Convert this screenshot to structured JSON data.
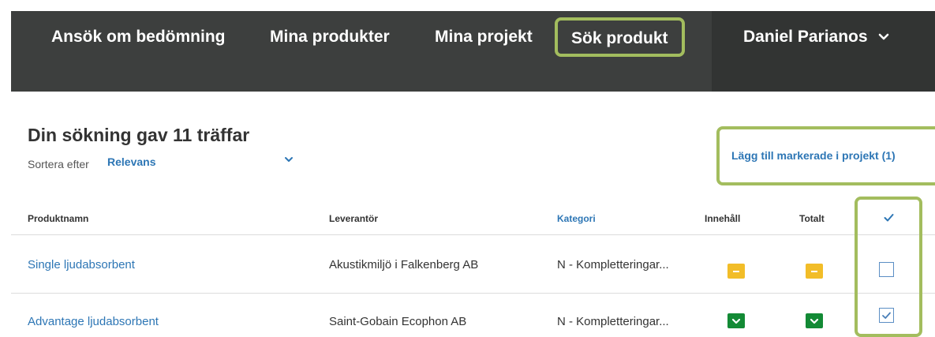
{
  "nav": {
    "items": [
      "Ansök om bedömning",
      "Mina produkter",
      "Mina projekt",
      "Sök produkt"
    ],
    "user_name": "Daniel Parianos"
  },
  "results": {
    "title": "Din sökning gav 11 träffar",
    "sort_label": "Sortera efter",
    "sort_value": "Relevans",
    "add_to_project": "Lägg till markerade i projekt (1)"
  },
  "table": {
    "headers": {
      "name": "Produktnamn",
      "supplier": "Leverantör",
      "category": "Kategori",
      "content": "Innehåll",
      "total": "Totalt"
    },
    "rows": [
      {
        "name": "Single ljudabsorbent",
        "supplier": "Akustikmiljö i Falkenberg AB",
        "category": "N - Kompletteringar...",
        "content_status": "yellow",
        "total_status": "yellow",
        "selected": false
      },
      {
        "name": "Advantage ljudabsorbent",
        "supplier": "Saint-Gobain Ecophon AB",
        "category": "N - Kompletteringar...",
        "content_status": "green",
        "total_status": "green",
        "selected": true
      }
    ]
  },
  "colors": {
    "nav_bg": "#3d3f3e",
    "nav_user_bg": "#323433",
    "highlight": "#a3bd5e",
    "link": "#2d76b5",
    "badge_yellow": "#f2bd28",
    "badge_green": "#138a35"
  },
  "icons": [
    "chevron-down-icon",
    "checkmark-icon",
    "minus-icon",
    "checkbox-icon"
  ]
}
